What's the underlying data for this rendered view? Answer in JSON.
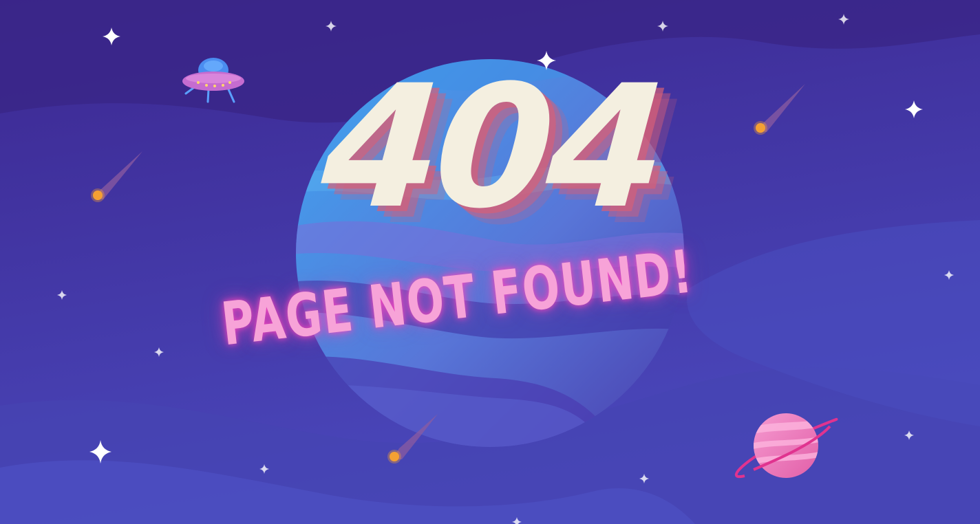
{
  "error": {
    "code": "404",
    "message": "PAGE NOT FOUND!"
  },
  "illustration": {
    "theme": "outer-space",
    "elements": [
      "planet",
      "ufo",
      "comet",
      "ringed-planet",
      "sparkle-star"
    ]
  },
  "colors": {
    "background": "#3e2a93",
    "planet": "#4f74d9",
    "code_text": "#f4efe0",
    "code_shadow": "#d66078",
    "message_text": "#f7a3d8",
    "message_glow": "#ff46be",
    "ringed_planet": "#ee7fc2",
    "comet": "#f5a033"
  }
}
